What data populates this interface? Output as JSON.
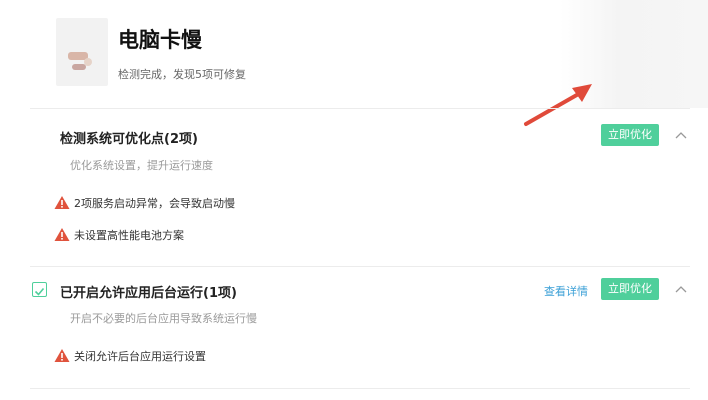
{
  "header": {
    "title": "电脑卡慢",
    "subtitle": "检测完成，发现5项可修复"
  },
  "sections": [
    {
      "title": "检测系统可优化点(2项)",
      "description": "优化系统设置，提升运行速度",
      "button_label": "立即优化",
      "items": [
        {
          "text": "2项服务启动异常，会导致启动慢",
          "icon": "warning-icon"
        },
        {
          "text": "未设置高性能电池方案",
          "icon": "warning-icon"
        }
      ]
    },
    {
      "title": "已开启允许应用后台运行(1项)",
      "description": "开启不必要的后台应用导致系统运行慢",
      "link_label": "查看详情",
      "button_label": "立即优化",
      "checked": true,
      "items": [
        {
          "text": "关闭允许后台应用运行设置",
          "icon": "warning-icon"
        }
      ]
    }
  ],
  "colors": {
    "accent_green": "#4fcf9b",
    "link_blue": "#3a9fd6",
    "warning_red": "#e0533d",
    "annotation_arrow": "#e04a3a"
  }
}
